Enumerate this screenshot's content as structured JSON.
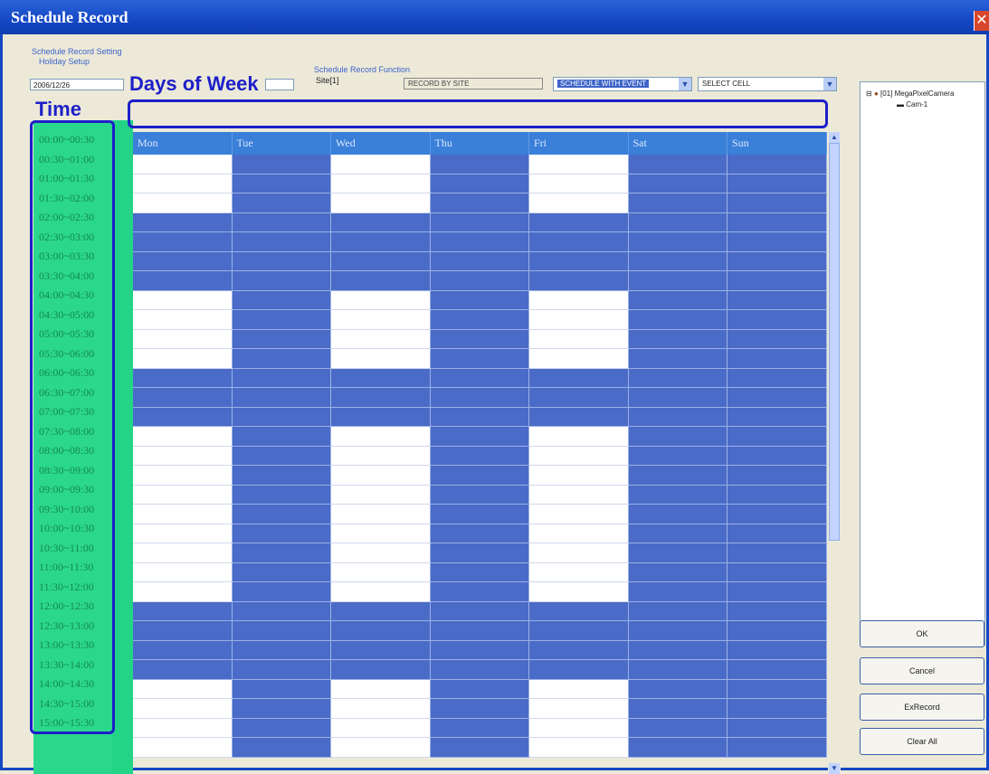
{
  "window": {
    "title": "Schedule Record",
    "close_glyph": "✕"
  },
  "settings": {
    "group_label": "Schedule Record Setting",
    "holiday_label": "Holiday Setup",
    "holiday_value": "2006/12/26",
    "function_label": "Schedule Record Function",
    "site_value": "Site[1]",
    "record_by_site": "RECORD BY SITE",
    "mode_value": "SCHEDULE WITH EVENT",
    "select_value": "SELECT CELL"
  },
  "annotations": {
    "time": "Time",
    "days": "Days of Week"
  },
  "days": [
    "Mon",
    "Tue",
    "Wed",
    "Thu",
    "Fri",
    "Sat",
    "Sun"
  ],
  "time_slots": [
    "00:00~00:30",
    "00:30~01:00",
    "01:00~01:30",
    "01:30~02:00",
    "02:00~02:30",
    "02:30~03:00",
    "03:00~03:30",
    "03:30~04:00",
    "04:00~04:30",
    "04:30~05:00",
    "05:00~05:30",
    "05:30~06:00",
    "06:00~06:30",
    "06:30~07:00",
    "07:00~07:30",
    "07:30~08:00",
    "08:00~08:30",
    "08:30~09:00",
    "09:00~09:30",
    "09:30~10:00",
    "10:00~10:30",
    "10:30~11:00",
    "11:00~11:30",
    "11:30~12:00",
    "12:00~12:30",
    "12:30~13:00",
    "13:00~13:30",
    "13:30~14:00",
    "14:00~14:30",
    "14:30~15:00",
    "15:00~15:30"
  ],
  "schedule_rows": [
    [
      0,
      1,
      0,
      1,
      0,
      1,
      1
    ],
    [
      0,
      1,
      0,
      1,
      0,
      1,
      1
    ],
    [
      0,
      1,
      0,
      1,
      0,
      1,
      1
    ],
    [
      1,
      1,
      1,
      1,
      1,
      1,
      1
    ],
    [
      1,
      1,
      1,
      1,
      1,
      1,
      1
    ],
    [
      1,
      1,
      1,
      1,
      1,
      1,
      1
    ],
    [
      1,
      1,
      1,
      1,
      1,
      1,
      1
    ],
    [
      0,
      1,
      0,
      1,
      0,
      1,
      1
    ],
    [
      0,
      1,
      0,
      1,
      0,
      1,
      1
    ],
    [
      0,
      1,
      0,
      1,
      0,
      1,
      1
    ],
    [
      0,
      1,
      0,
      1,
      0,
      1,
      1
    ],
    [
      1,
      1,
      1,
      1,
      1,
      1,
      1
    ],
    [
      1,
      1,
      1,
      1,
      1,
      1,
      1
    ],
    [
      1,
      1,
      1,
      1,
      1,
      1,
      1
    ],
    [
      0,
      1,
      0,
      1,
      0,
      1,
      1
    ],
    [
      0,
      1,
      0,
      1,
      0,
      1,
      1
    ],
    [
      0,
      1,
      0,
      1,
      0,
      1,
      1
    ],
    [
      0,
      1,
      0,
      1,
      0,
      1,
      1
    ],
    [
      0,
      1,
      0,
      1,
      0,
      1,
      1
    ],
    [
      0,
      1,
      0,
      1,
      0,
      1,
      1
    ],
    [
      0,
      1,
      0,
      1,
      0,
      1,
      1
    ],
    [
      0,
      1,
      0,
      1,
      0,
      1,
      1
    ],
    [
      0,
      1,
      0,
      1,
      0,
      1,
      1
    ],
    [
      1,
      1,
      1,
      1,
      1,
      1,
      1
    ],
    [
      1,
      1,
      1,
      1,
      1,
      1,
      1
    ],
    [
      1,
      1,
      1,
      1,
      1,
      1,
      1
    ],
    [
      1,
      1,
      1,
      1,
      1,
      1,
      1
    ],
    [
      0,
      1,
      0,
      1,
      0,
      1,
      1
    ],
    [
      0,
      1,
      0,
      1,
      0,
      1,
      1
    ],
    [
      0,
      1,
      0,
      1,
      0,
      1,
      1
    ],
    [
      0,
      1,
      0,
      1,
      0,
      1,
      1
    ]
  ],
  "tree": {
    "camera": "[01] MegaPixelCamera",
    "channel": "Cam-1"
  },
  "buttons": {
    "ok": "OK",
    "cancel": "Cancel",
    "exrecord": "ExRecord",
    "clear_all": "Clear All"
  },
  "colors": {
    "scheduled": "#4a6bc8",
    "unscheduled": "#ffffff",
    "time_column": "#2bd78c",
    "annotation": "#1d1fc9"
  }
}
